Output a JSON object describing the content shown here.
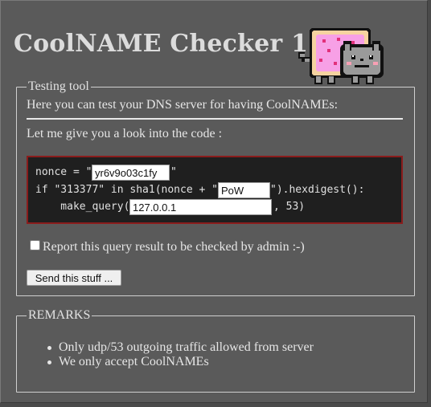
{
  "header": {
    "title": "CoolNAME Checker 1.0"
  },
  "logo": {
    "icon": "nyan-cat-icon"
  },
  "testing_tool": {
    "legend": "Testing tool",
    "intro": "Here you can test your DNS server for having CoolNAMEs:",
    "code_intro": "Let me give you a look into the code :",
    "code": {
      "line1_prefix": "nonce = \"",
      "line1_suffix": "\"",
      "nonce_value": "yr6v9o03c1fy",
      "line2_prefix": "if \"313377\" in sha1(nonce + \"",
      "line2_suffix": "\").hexdigest():",
      "pow_value": "PoW",
      "line3_prefix": "    make_query(",
      "line3_suffix": ", 53)",
      "query_value": "127.0.0.1"
    },
    "report_label": "Report this query result to be checked by admin :-)",
    "report_checked": false,
    "submit_label": "Send this stuff ..."
  },
  "remarks": {
    "legend": "REMARKS",
    "items": [
      "Only udp/53 outgoing traffic allowed from server",
      "We only accept CoolNAMEs"
    ]
  },
  "colors": {
    "page_bg": "#5a5a5a",
    "code_bg": "#1f1f1f",
    "code_border": "#8a1c1c",
    "text": "#e6e6e6"
  }
}
